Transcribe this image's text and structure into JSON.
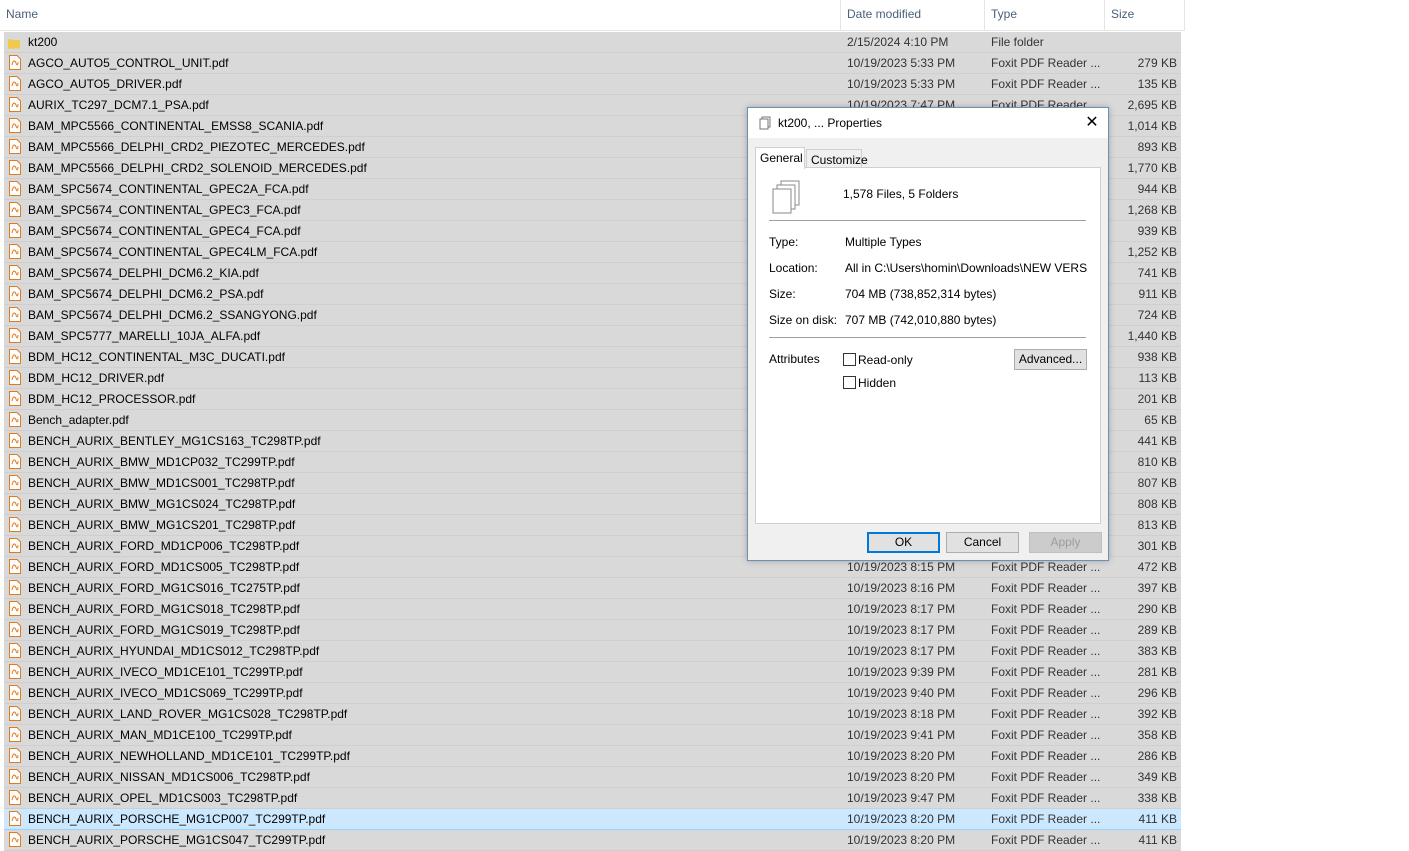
{
  "columns": {
    "name": "Name",
    "date": "Date modified",
    "type": "Type",
    "size": "Size"
  },
  "files": [
    {
      "name": "kt200",
      "date": "2/15/2024 4:10 PM",
      "type": "File folder",
      "size": "",
      "icon": "folder-icon"
    },
    {
      "name": "AGCO_AUTO5_CONTROL_UNIT.pdf",
      "date": "10/19/2023 5:33 PM",
      "type": "Foxit PDF Reader ...",
      "size": "279 KB",
      "icon": "pdf-icon"
    },
    {
      "name": "AGCO_AUTO5_DRIVER.pdf",
      "date": "10/19/2023 5:33 PM",
      "type": "Foxit PDF Reader ...",
      "size": "135 KB",
      "icon": "pdf-icon"
    },
    {
      "name": "AURIX_TC297_DCM7.1_PSA.pdf",
      "date": "10/19/2023 7:47 PM",
      "type": "Foxit PDF Reader ...",
      "size": "2,695 KB",
      "icon": "pdf-icon"
    },
    {
      "name": "BAM_MPC5566_CONTINENTAL_EMSS8_SCANIA.pdf",
      "date": "",
      "type": "",
      "size": "1,014 KB",
      "icon": "pdf-icon"
    },
    {
      "name": "BAM_MPC5566_DELPHI_CRD2_PIEZOTEC_MERCEDES.pdf",
      "date": "",
      "type": "",
      "size": "893 KB",
      "icon": "pdf-icon"
    },
    {
      "name": "BAM_MPC5566_DELPHI_CRD2_SOLENOID_MERCEDES.pdf",
      "date": "",
      "type": "",
      "size": "1,770 KB",
      "icon": "pdf-icon"
    },
    {
      "name": "BAM_SPC5674_CONTINENTAL_GPEC2A_FCA.pdf",
      "date": "",
      "type": "",
      "size": "944 KB",
      "icon": "pdf-icon"
    },
    {
      "name": "BAM_SPC5674_CONTINENTAL_GPEC3_FCA.pdf",
      "date": "",
      "type": "",
      "size": "1,268 KB",
      "icon": "pdf-icon"
    },
    {
      "name": "BAM_SPC5674_CONTINENTAL_GPEC4_FCA.pdf",
      "date": "",
      "type": "",
      "size": "939 KB",
      "icon": "pdf-icon"
    },
    {
      "name": "BAM_SPC5674_CONTINENTAL_GPEC4LM_FCA.pdf",
      "date": "",
      "type": "",
      "size": "1,252 KB",
      "icon": "pdf-icon"
    },
    {
      "name": "BAM_SPC5674_DELPHI_DCM6.2_KIA.pdf",
      "date": "",
      "type": "",
      "size": "741 KB",
      "icon": "pdf-icon"
    },
    {
      "name": "BAM_SPC5674_DELPHI_DCM6.2_PSA.pdf",
      "date": "",
      "type": "",
      "size": "911 KB",
      "icon": "pdf-icon"
    },
    {
      "name": "BAM_SPC5674_DELPHI_DCM6.2_SSANGYONG.pdf",
      "date": "",
      "type": "",
      "size": "724 KB",
      "icon": "pdf-icon"
    },
    {
      "name": "BAM_SPC5777_MARELLI_10JA_ALFA.pdf",
      "date": "",
      "type": "",
      "size": "1,440 KB",
      "icon": "pdf-icon"
    },
    {
      "name": "BDM_HC12_CONTINENTAL_M3C_DUCATI.pdf",
      "date": "",
      "type": "",
      "size": "938 KB",
      "icon": "pdf-icon"
    },
    {
      "name": "BDM_HC12_DRIVER.pdf",
      "date": "",
      "type": "",
      "size": "113 KB",
      "icon": "pdf-icon"
    },
    {
      "name": "BDM_HC12_PROCESSOR.pdf",
      "date": "",
      "type": "",
      "size": "201 KB",
      "icon": "pdf-icon"
    },
    {
      "name": "Bench_adapter.pdf",
      "date": "",
      "type": "",
      "size": "65 KB",
      "icon": "pdf-icon"
    },
    {
      "name": "BENCH_AURIX_BENTLEY_MG1CS163_TC298TP.pdf",
      "date": "",
      "type": "",
      "size": "441 KB",
      "icon": "pdf-icon"
    },
    {
      "name": "BENCH_AURIX_BMW_MD1CP032_TC299TP.pdf",
      "date": "",
      "type": "",
      "size": "810 KB",
      "icon": "pdf-icon"
    },
    {
      "name": "BENCH_AURIX_BMW_MD1CS001_TC298TP.pdf",
      "date": "",
      "type": "",
      "size": "807 KB",
      "icon": "pdf-icon"
    },
    {
      "name": "BENCH_AURIX_BMW_MG1CS024_TC298TP.pdf",
      "date": "",
      "type": "",
      "size": "808 KB",
      "icon": "pdf-icon"
    },
    {
      "name": "BENCH_AURIX_BMW_MG1CS201_TC298TP.pdf",
      "date": "",
      "type": "",
      "size": "813 KB",
      "icon": "pdf-icon"
    },
    {
      "name": "BENCH_AURIX_FORD_MD1CP006_TC298TP.pdf",
      "date": "",
      "type": "",
      "size": "301 KB",
      "icon": "pdf-icon"
    },
    {
      "name": "BENCH_AURIX_FORD_MD1CS005_TC298TP.pdf",
      "date": "10/19/2023 8:15 PM",
      "type": "Foxit PDF Reader ...",
      "size": "472 KB",
      "icon": "pdf-icon"
    },
    {
      "name": "BENCH_AURIX_FORD_MG1CS016_TC275TP.pdf",
      "date": "10/19/2023 8:16 PM",
      "type": "Foxit PDF Reader ...",
      "size": "397 KB",
      "icon": "pdf-icon"
    },
    {
      "name": "BENCH_AURIX_FORD_MG1CS018_TC298TP.pdf",
      "date": "10/19/2023 8:17 PM",
      "type": "Foxit PDF Reader ...",
      "size": "290 KB",
      "icon": "pdf-icon"
    },
    {
      "name": "BENCH_AURIX_FORD_MG1CS019_TC298TP.pdf",
      "date": "10/19/2023 8:17 PM",
      "type": "Foxit PDF Reader ...",
      "size": "289 KB",
      "icon": "pdf-icon"
    },
    {
      "name": "BENCH_AURIX_HYUNDAI_MD1CS012_TC298TP.pdf",
      "date": "10/19/2023 8:17 PM",
      "type": "Foxit PDF Reader ...",
      "size": "383 KB",
      "icon": "pdf-icon"
    },
    {
      "name": "BENCH_AURIX_IVECO_MD1CE101_TC299TP.pdf",
      "date": "10/19/2023 9:39 PM",
      "type": "Foxit PDF Reader ...",
      "size": "281 KB",
      "icon": "pdf-icon"
    },
    {
      "name": "BENCH_AURIX_IVECO_MD1CS069_TC299TP.pdf",
      "date": "10/19/2023 9:40 PM",
      "type": "Foxit PDF Reader ...",
      "size": "296 KB",
      "icon": "pdf-icon"
    },
    {
      "name": "BENCH_AURIX_LAND_ROVER_MG1CS028_TC298TP.pdf",
      "date": "10/19/2023 8:18 PM",
      "type": "Foxit PDF Reader ...",
      "size": "392 KB",
      "icon": "pdf-icon"
    },
    {
      "name": "BENCH_AURIX_MAN_MD1CE100_TC299TP.pdf",
      "date": "10/19/2023 9:41 PM",
      "type": "Foxit PDF Reader ...",
      "size": "358 KB",
      "icon": "pdf-icon"
    },
    {
      "name": "BENCH_AURIX_NEWHOLLAND_MD1CE101_TC299TP.pdf",
      "date": "10/19/2023 8:20 PM",
      "type": "Foxit PDF Reader ...",
      "size": "286 KB",
      "icon": "pdf-icon"
    },
    {
      "name": "BENCH_AURIX_NISSAN_MD1CS006_TC298TP.pdf",
      "date": "10/19/2023 8:20 PM",
      "type": "Foxit PDF Reader ...",
      "size": "349 KB",
      "icon": "pdf-icon"
    },
    {
      "name": "BENCH_AURIX_OPEL_MD1CS003_TC298TP.pdf",
      "date": "10/19/2023 9:47 PM",
      "type": "Foxit PDF Reader ...",
      "size": "338 KB",
      "icon": "pdf-icon"
    },
    {
      "name": "BENCH_AURIX_PORSCHE_MG1CP007_TC299TP.pdf",
      "date": "10/19/2023 8:20 PM",
      "type": "Foxit PDF Reader ...",
      "size": "411 KB",
      "icon": "pdf-icon",
      "selected": true
    },
    {
      "name": "BENCH_AURIX_PORSCHE_MG1CS047_TC299TP.pdf",
      "date": "10/19/2023 8:20 PM",
      "type": "Foxit PDF Reader ...",
      "size": "411 KB",
      "icon": "pdf-icon"
    }
  ],
  "dialog": {
    "title": "kt200, ... Properties",
    "close": "✕",
    "tabs": [
      "General",
      "Customize"
    ],
    "summary": "1,578 Files, 5 Folders",
    "type_label": "Type:",
    "type_value": "Multiple Types",
    "location_label": "Location:",
    "location_value": "All in C:\\Users\\homin\\Downloads\\NEW VERSION PIN",
    "size_label": "Size:",
    "size_value": "704 MB (738,852,314 bytes)",
    "size_on_disk_label": "Size on disk:",
    "size_on_disk_value": "707 MB (742,010,880 bytes)",
    "attributes_label": "Attributes",
    "readonly_label": "Read-only",
    "hidden_label": "Hidden",
    "advanced_label": "Advanced...",
    "ok_label": "OK",
    "cancel_label": "Cancel",
    "apply_label": "Apply"
  },
  "colors": {
    "row_bg": "#d9d9d9",
    "selected_bg": "#cce8ff",
    "pdf_icon": "#e07a1f",
    "folder_icon": "#f2c94c",
    "accent": "#0078d7"
  }
}
